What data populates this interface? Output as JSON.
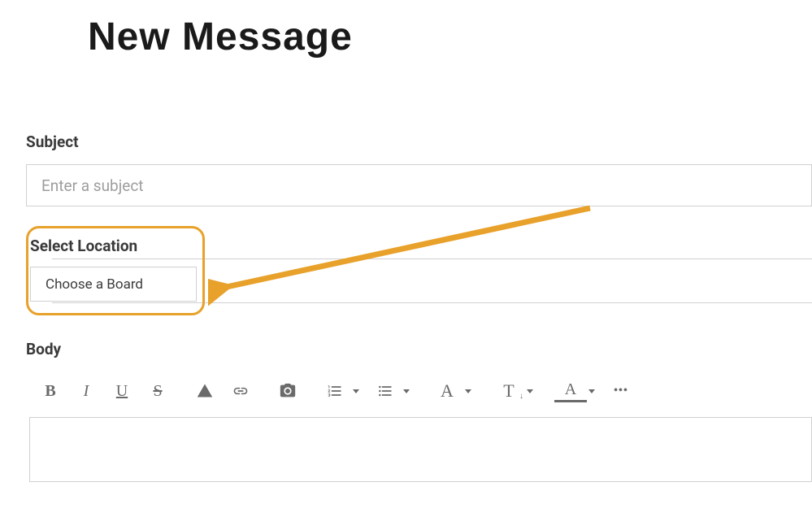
{
  "page": {
    "title": "New Message"
  },
  "subject": {
    "label": "Subject",
    "placeholder": "Enter a subject",
    "value": ""
  },
  "location": {
    "label": "Select Location",
    "button": "Choose a Board"
  },
  "body": {
    "label": "Body"
  },
  "toolbar": {
    "bold": "B",
    "italic": "I",
    "underline": "U",
    "strike": "S",
    "ellipsis": "•••"
  }
}
